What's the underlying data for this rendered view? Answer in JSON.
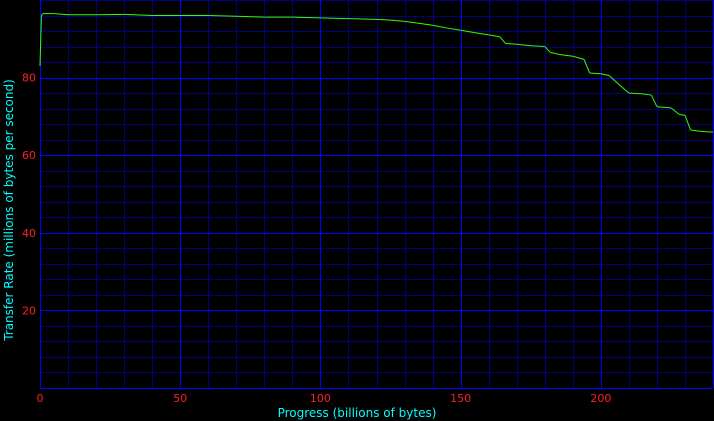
{
  "chart_data": {
    "type": "line",
    "title": "",
    "xlabel": "Progress (billions of bytes)",
    "ylabel": "Transfer Rate (millions of bytes per second)",
    "xlim": [
      0,
      240
    ],
    "ylim": [
      0,
      100
    ],
    "x_major_ticks": [
      0,
      50,
      100,
      150,
      200
    ],
    "y_major_ticks": [
      20,
      40,
      60,
      80
    ],
    "x_tick_labels": [
      "0",
      "50",
      "100",
      "150",
      "200"
    ],
    "y_tick_labels": [
      "20",
      "40",
      "60",
      "80"
    ],
    "x_minor_step": 10,
    "y_minor_step": 4,
    "grid": true,
    "legend": "none",
    "colors": {
      "background": "#000000",
      "minor_grid": "#000080",
      "major_grid": "#0000ff",
      "series": "#33ff00",
      "tick_labels": "#ff2020",
      "axis_titles": "#00ffff"
    },
    "series": [
      {
        "x": [
          0,
          0.5,
          1,
          5,
          10,
          20,
          30,
          40,
          50,
          60,
          70,
          80,
          90,
          100,
          110,
          120,
          125,
          130,
          135,
          140,
          145,
          150,
          155,
          160,
          164,
          166,
          170,
          175,
          180,
          182,
          185,
          190,
          194,
          196,
          200,
          203,
          206,
          210,
          215,
          218,
          220,
          225,
          228,
          230,
          232,
          235,
          238,
          240
        ],
        "y": [
          83,
          96,
          96.5,
          96.5,
          96.2,
          96.2,
          96.3,
          96.0,
          96.0,
          96.0,
          95.8,
          95.6,
          95.6,
          95.4,
          95.2,
          95.0,
          94.8,
          94.5,
          94.0,
          93.5,
          92.8,
          92.2,
          91.6,
          91.0,
          90.5,
          88.8,
          88.6,
          88.2,
          88.0,
          86.5,
          86.0,
          85.5,
          84.7,
          81.2,
          81.0,
          80.5,
          78.5,
          76.0,
          75.8,
          75.5,
          72.5,
          72.2,
          70.5,
          70.3,
          66.5,
          66.2,
          66.0,
          66.0
        ]
      }
    ]
  }
}
